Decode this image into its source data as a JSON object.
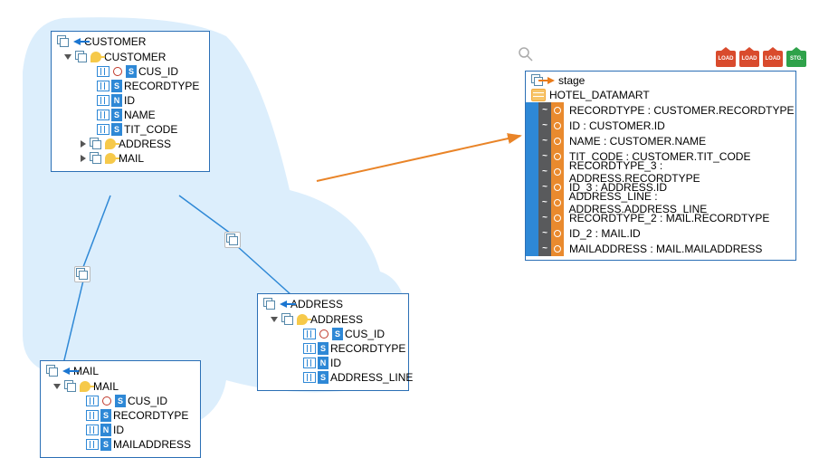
{
  "source": {
    "customer": {
      "title": "CUSTOMER",
      "table": "CUSTOMER",
      "fields": [
        {
          "badge": "S",
          "name": "CUS_ID"
        },
        {
          "badge": "S",
          "name": "RECORDTYPE"
        },
        {
          "badge": "N",
          "name": "ID"
        },
        {
          "badge": "S",
          "name": "NAME"
        },
        {
          "badge": "S",
          "name": "TIT_CODE"
        }
      ],
      "sub": [
        "ADDRESS",
        "MAIL"
      ]
    },
    "address": {
      "title": "ADDRESS",
      "table": "ADDRESS",
      "fields": [
        {
          "badge": "S",
          "name": "CUS_ID"
        },
        {
          "badge": "S",
          "name": "RECORDTYPE"
        },
        {
          "badge": "N",
          "name": "ID"
        },
        {
          "badge": "S",
          "name": "ADDRESS_LINE"
        }
      ]
    },
    "mail": {
      "title": "MAIL",
      "table": "MAIL",
      "fields": [
        {
          "badge": "S",
          "name": "CUS_ID"
        },
        {
          "badge": "S",
          "name": "RECORDTYPE"
        },
        {
          "badge": "N",
          "name": "ID"
        },
        {
          "badge": "S",
          "name": "MAILADDRESS"
        }
      ]
    }
  },
  "target": {
    "name": "stage",
    "datastore": "HOTEL_DATAMART",
    "mappings": [
      "RECORDTYPE : CUSTOMER.RECORDTYPE",
      "ID : CUSTOMER.ID",
      "NAME : CUSTOMER.NAME",
      "TIT_CODE : CUSTOMER.TIT_CODE",
      "RECORDTYPE_3 : ADDRESS.RECORDTYPE",
      "ID_3 : ADDRESS.ID",
      "ADDRESS_LINE : ADDRESS.ADDRESS_LINE",
      "RECORDTYPE_2 : MAIL.RECORDTYPE",
      "ID_2 : MAIL.ID",
      "MAILADDRESS : MAIL.MAILADDRESS"
    ]
  },
  "tags": [
    "LOAD",
    "LOAD",
    "LOAD",
    "STG."
  ]
}
